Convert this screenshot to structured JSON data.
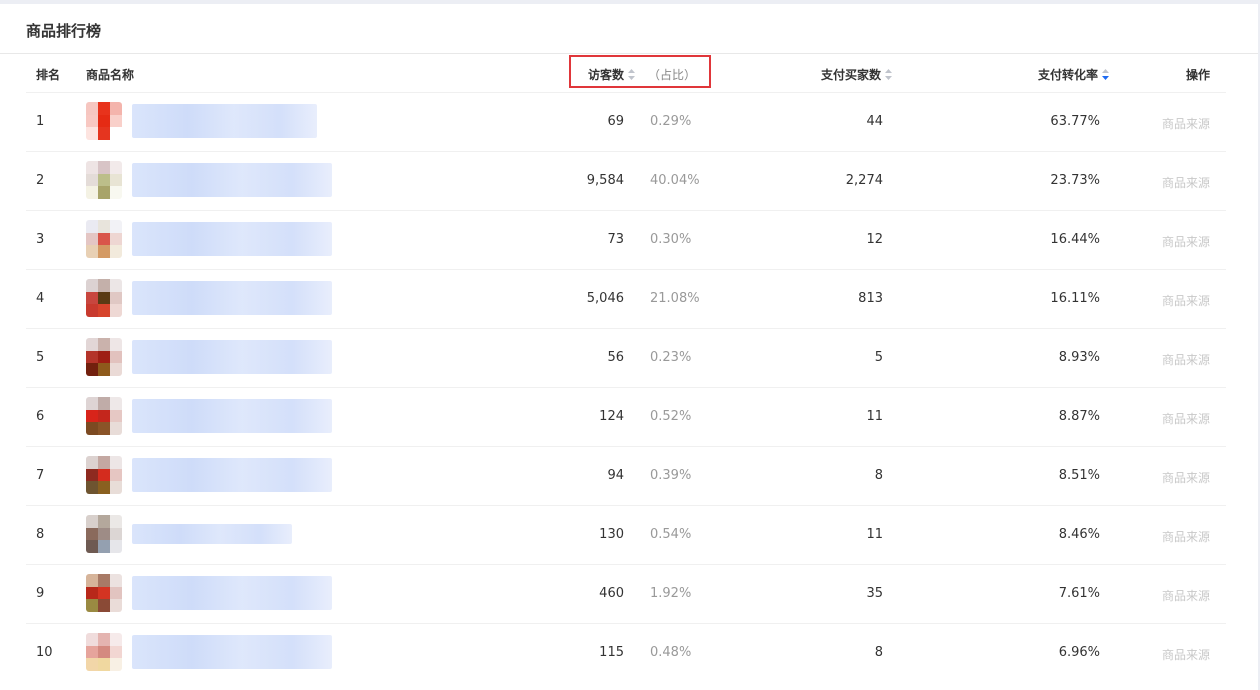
{
  "page": {
    "title": "商品排行榜"
  },
  "table": {
    "headers": {
      "rank": "排名",
      "name": "商品名称",
      "visitors": "访客数",
      "share": "（占比）",
      "buyers": "支付买家数",
      "conversion": "支付转化率",
      "action": "操作"
    },
    "sort_icons": {
      "visitors": "sort-neutral-icon",
      "buyers": "sort-neutral-icon",
      "conversion": "sort-descending-icon"
    },
    "sort_active_color": "#1f6bf2",
    "highlight_color": "#e0363a",
    "rows": [
      {
        "rank": "1",
        "visitors": "69",
        "share": "0.29%",
        "buyers": "44",
        "conversion": "63.77%",
        "action": "商品来源"
      },
      {
        "rank": "2",
        "visitors": "9,584",
        "share": "40.04%",
        "buyers": "2,274",
        "conversion": "23.73%",
        "action": "商品来源"
      },
      {
        "rank": "3",
        "visitors": "73",
        "share": "0.30%",
        "buyers": "12",
        "conversion": "16.44%",
        "action": "商品来源"
      },
      {
        "rank": "4",
        "visitors": "5,046",
        "share": "21.08%",
        "buyers": "813",
        "conversion": "16.11%",
        "action": "商品来源"
      },
      {
        "rank": "5",
        "visitors": "56",
        "share": "0.23%",
        "buyers": "5",
        "conversion": "8.93%",
        "action": "商品来源"
      },
      {
        "rank": "6",
        "visitors": "124",
        "share": "0.52%",
        "buyers": "11",
        "conversion": "8.87%",
        "action": "商品来源"
      },
      {
        "rank": "7",
        "visitors": "94",
        "share": "0.39%",
        "buyers": "8",
        "conversion": "8.51%",
        "action": "商品来源"
      },
      {
        "rank": "8",
        "visitors": "130",
        "share": "0.54%",
        "buyers": "11",
        "conversion": "8.46%",
        "action": "商品来源"
      },
      {
        "rank": "9",
        "visitors": "460",
        "share": "1.92%",
        "buyers": "35",
        "conversion": "7.61%",
        "action": "商品来源"
      },
      {
        "rank": "10",
        "visitors": "115",
        "share": "0.48%",
        "buyers": "8",
        "conversion": "6.96%",
        "action": "商品来源"
      }
    ]
  }
}
